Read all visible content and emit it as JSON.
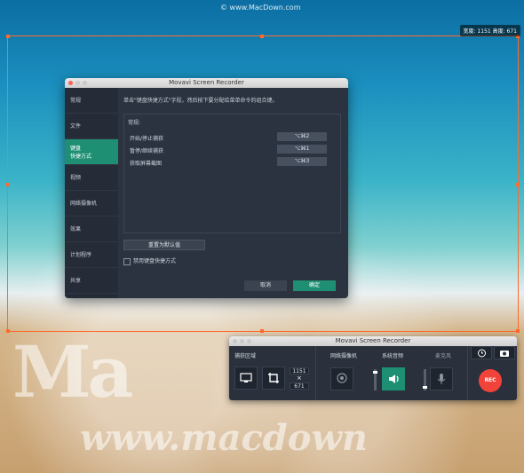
{
  "watermark": "© www.MacDown.com",
  "size_readout": "宽度: 1151  高度: 671",
  "sand_watermark": {
    "brand": "Ma",
    "url": "www.macdown"
  },
  "dialog": {
    "title": "Movavi Screen Recorder",
    "sidebar": [
      {
        "label": "常规"
      },
      {
        "label": "文件"
      },
      {
        "label": "键盘\n快捷方式",
        "active": true
      },
      {
        "label": "视频"
      },
      {
        "label": "网络摄像机"
      },
      {
        "label": "效果"
      },
      {
        "label": "计划程序"
      },
      {
        "label": "共享"
      }
    ],
    "hint": "单击\"键盘快捷方式\"字段，然后按下要分配给菜单命令的组合键。",
    "group_title": "常规:",
    "shortcuts": [
      {
        "label": "开始/停止捕获",
        "key": "⌥⌘2"
      },
      {
        "label": "暂停/继续捕获",
        "key": "⌥⌘1"
      },
      {
        "label": "获取屏幕截图",
        "key": "⌥⌘3"
      }
    ],
    "reset_label": "重置为默认值",
    "disable_label": "禁用键盘快捷方式",
    "cancel_label": "取消",
    "ok_label": "确定"
  },
  "recorder": {
    "title": "Movavi Screen Recorder",
    "capture_area_label": "捕获区域",
    "width_value": "1151",
    "height_value": "671",
    "times_sign": "×",
    "webcam_label": "网络摄像机",
    "system_audio_label": "系统音频",
    "mic_label": "麦克风",
    "rec_label": "REC",
    "icons": [
      "monitor-icon",
      "crop-icon",
      "webcam-icon",
      "speaker-icon",
      "microphone-icon",
      "alarm-clock-icon",
      "camera-icon"
    ],
    "accent": "#1e8f73",
    "rec_color": "#f2433a"
  }
}
